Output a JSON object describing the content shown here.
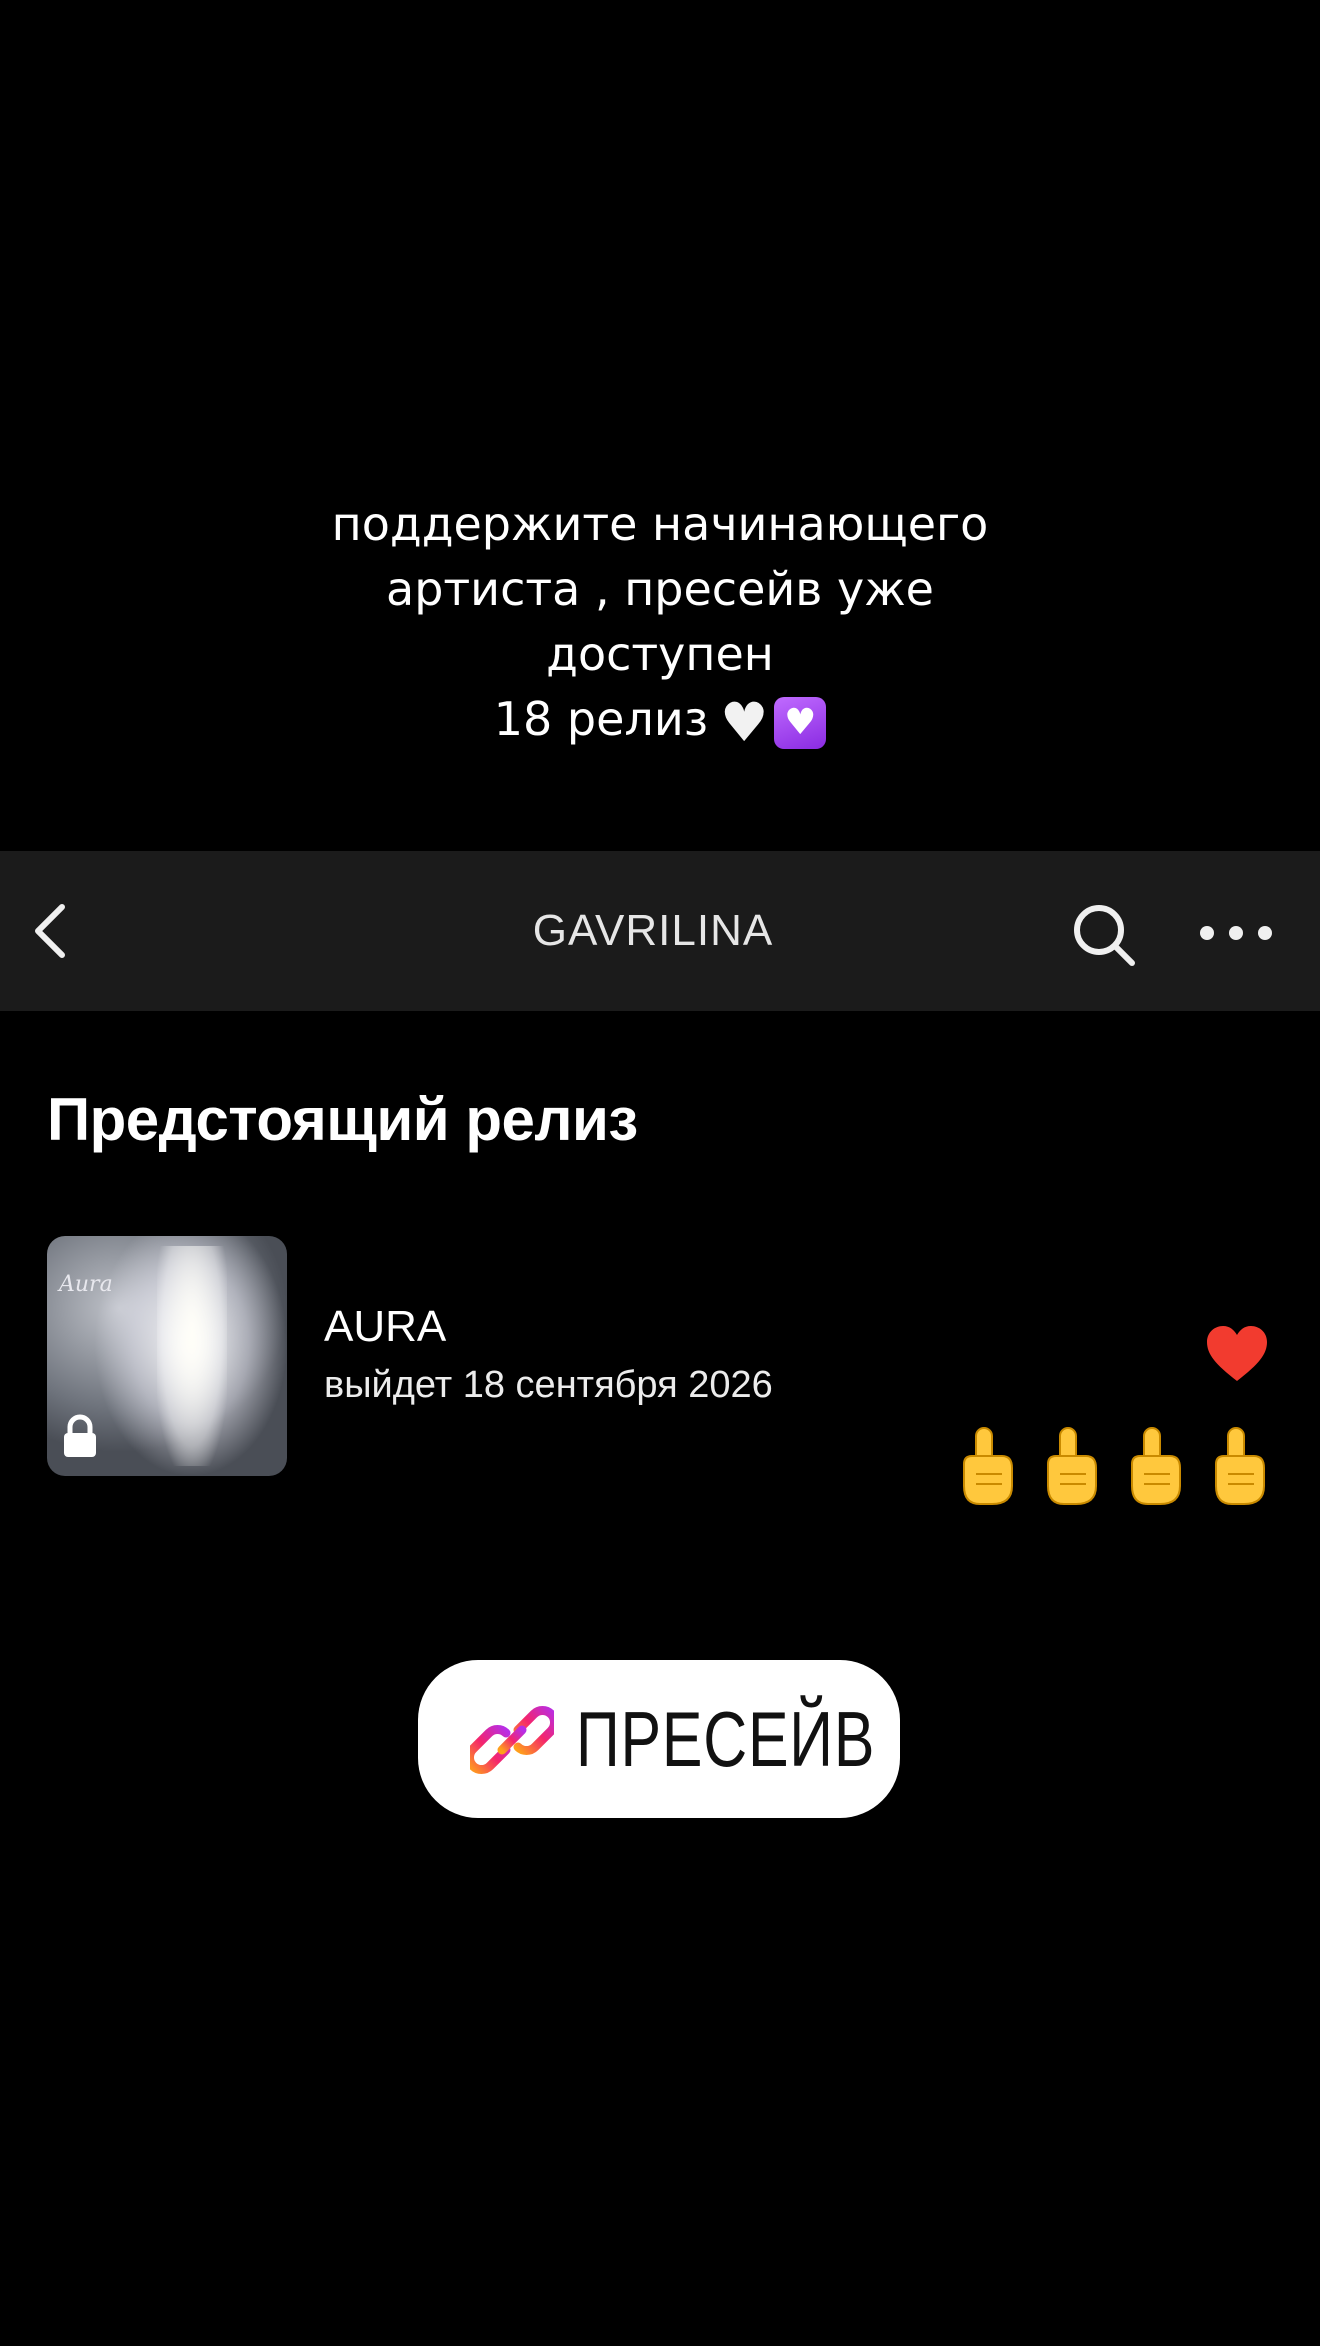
{
  "caption": {
    "line1": "поддержите начинающего",
    "line2": "артиста , пресейв уже",
    "line3": "доступен",
    "line4": "18 релиз"
  },
  "navbar": {
    "title": "GAVRILINA",
    "back_icon": "chevron-left-icon",
    "search_icon": "search-icon",
    "more_icon": "more-dots-icon"
  },
  "section": {
    "title": "Предстоящий релиз"
  },
  "release": {
    "cover_text": "Aura",
    "name": "AURA",
    "date": "выйдет 18 сентября 2026",
    "like_color": "#f23b2f"
  },
  "presave": {
    "label": "ПРЕСЕЙВ",
    "icon": "link-icon"
  }
}
